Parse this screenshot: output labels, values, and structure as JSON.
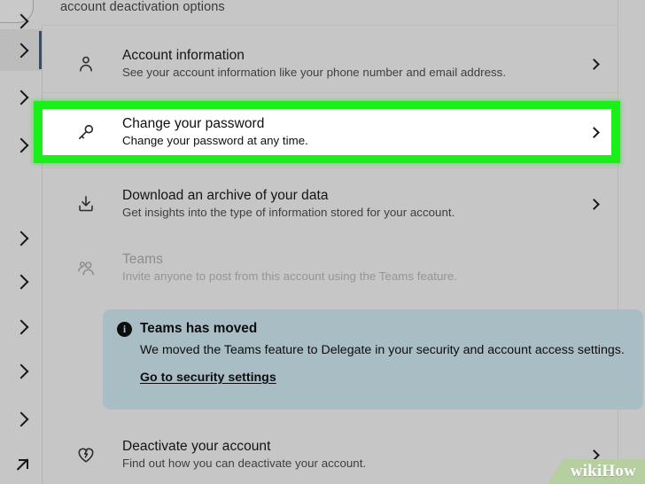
{
  "page": {
    "top_partial_text": "account deactivation options",
    "background_color": "#c6c6c6",
    "highlight_color": "#1aef1a"
  },
  "nav_rail": {
    "items": [
      {
        "name": "rail-chevron-1",
        "icon": "chevron-right-icon",
        "selected": true
      },
      {
        "name": "rail-chevron-2",
        "icon": "chevron-right-icon",
        "selected": false
      },
      {
        "name": "rail-chevron-3",
        "icon": "chevron-right-icon",
        "selected": false
      },
      {
        "name": "rail-chevron-4",
        "icon": "chevron-right-icon",
        "selected": false
      },
      {
        "name": "rail-chevron-5",
        "icon": "chevron-right-icon",
        "selected": false
      },
      {
        "name": "rail-chevron-6",
        "icon": "chevron-right-icon",
        "selected": false
      },
      {
        "name": "rail-chevron-7",
        "icon": "chevron-right-icon",
        "selected": false
      },
      {
        "name": "rail-chevron-8",
        "icon": "chevron-right-icon",
        "selected": false
      },
      {
        "name": "rail-chevron-9",
        "icon": "chevron-right-icon",
        "selected": false
      },
      {
        "name": "rail-external-link",
        "icon": "arrow-up-right-icon",
        "selected": false
      }
    ]
  },
  "settings_rows": [
    {
      "id": "account-information",
      "icon": "person-icon",
      "title": "Account information",
      "subtitle": "See your account information like your phone number and email address.",
      "disabled": false,
      "highlighted": false,
      "chevron": "chevron-right-icon"
    },
    {
      "id": "change-your-password",
      "icon": "key-icon",
      "title": "Change your password",
      "subtitle": "Change your password at any time.",
      "disabled": false,
      "highlighted": true,
      "chevron": "chevron-right-icon"
    },
    {
      "id": "download-archive",
      "icon": "download-icon",
      "title": "Download an archive of your data",
      "subtitle": "Get insights into the type of information stored for your account.",
      "disabled": false,
      "highlighted": false,
      "chevron": "chevron-right-icon"
    },
    {
      "id": "teams",
      "icon": "people-icon",
      "title": "Teams",
      "subtitle": "Invite anyone to post from this account using the Teams feature.",
      "disabled": true,
      "highlighted": false,
      "chevron": ""
    },
    {
      "id": "deactivate-your-account",
      "icon": "broken-heart-icon",
      "title": "Deactivate your account",
      "subtitle": "Find out how you can deactivate your account.",
      "disabled": false,
      "highlighted": false,
      "chevron": "chevron-right-icon"
    }
  ],
  "info_banner": {
    "icon": "info-circle-icon",
    "icon_glyph": "i",
    "title": "Teams has moved",
    "body": "We moved the Teams feature to Delegate in your security and account access settings.",
    "link_label": "Go to security settings",
    "background_color": "#a9bdc5"
  },
  "watermark": {
    "prefix": "wiki",
    "suffix": "How"
  }
}
